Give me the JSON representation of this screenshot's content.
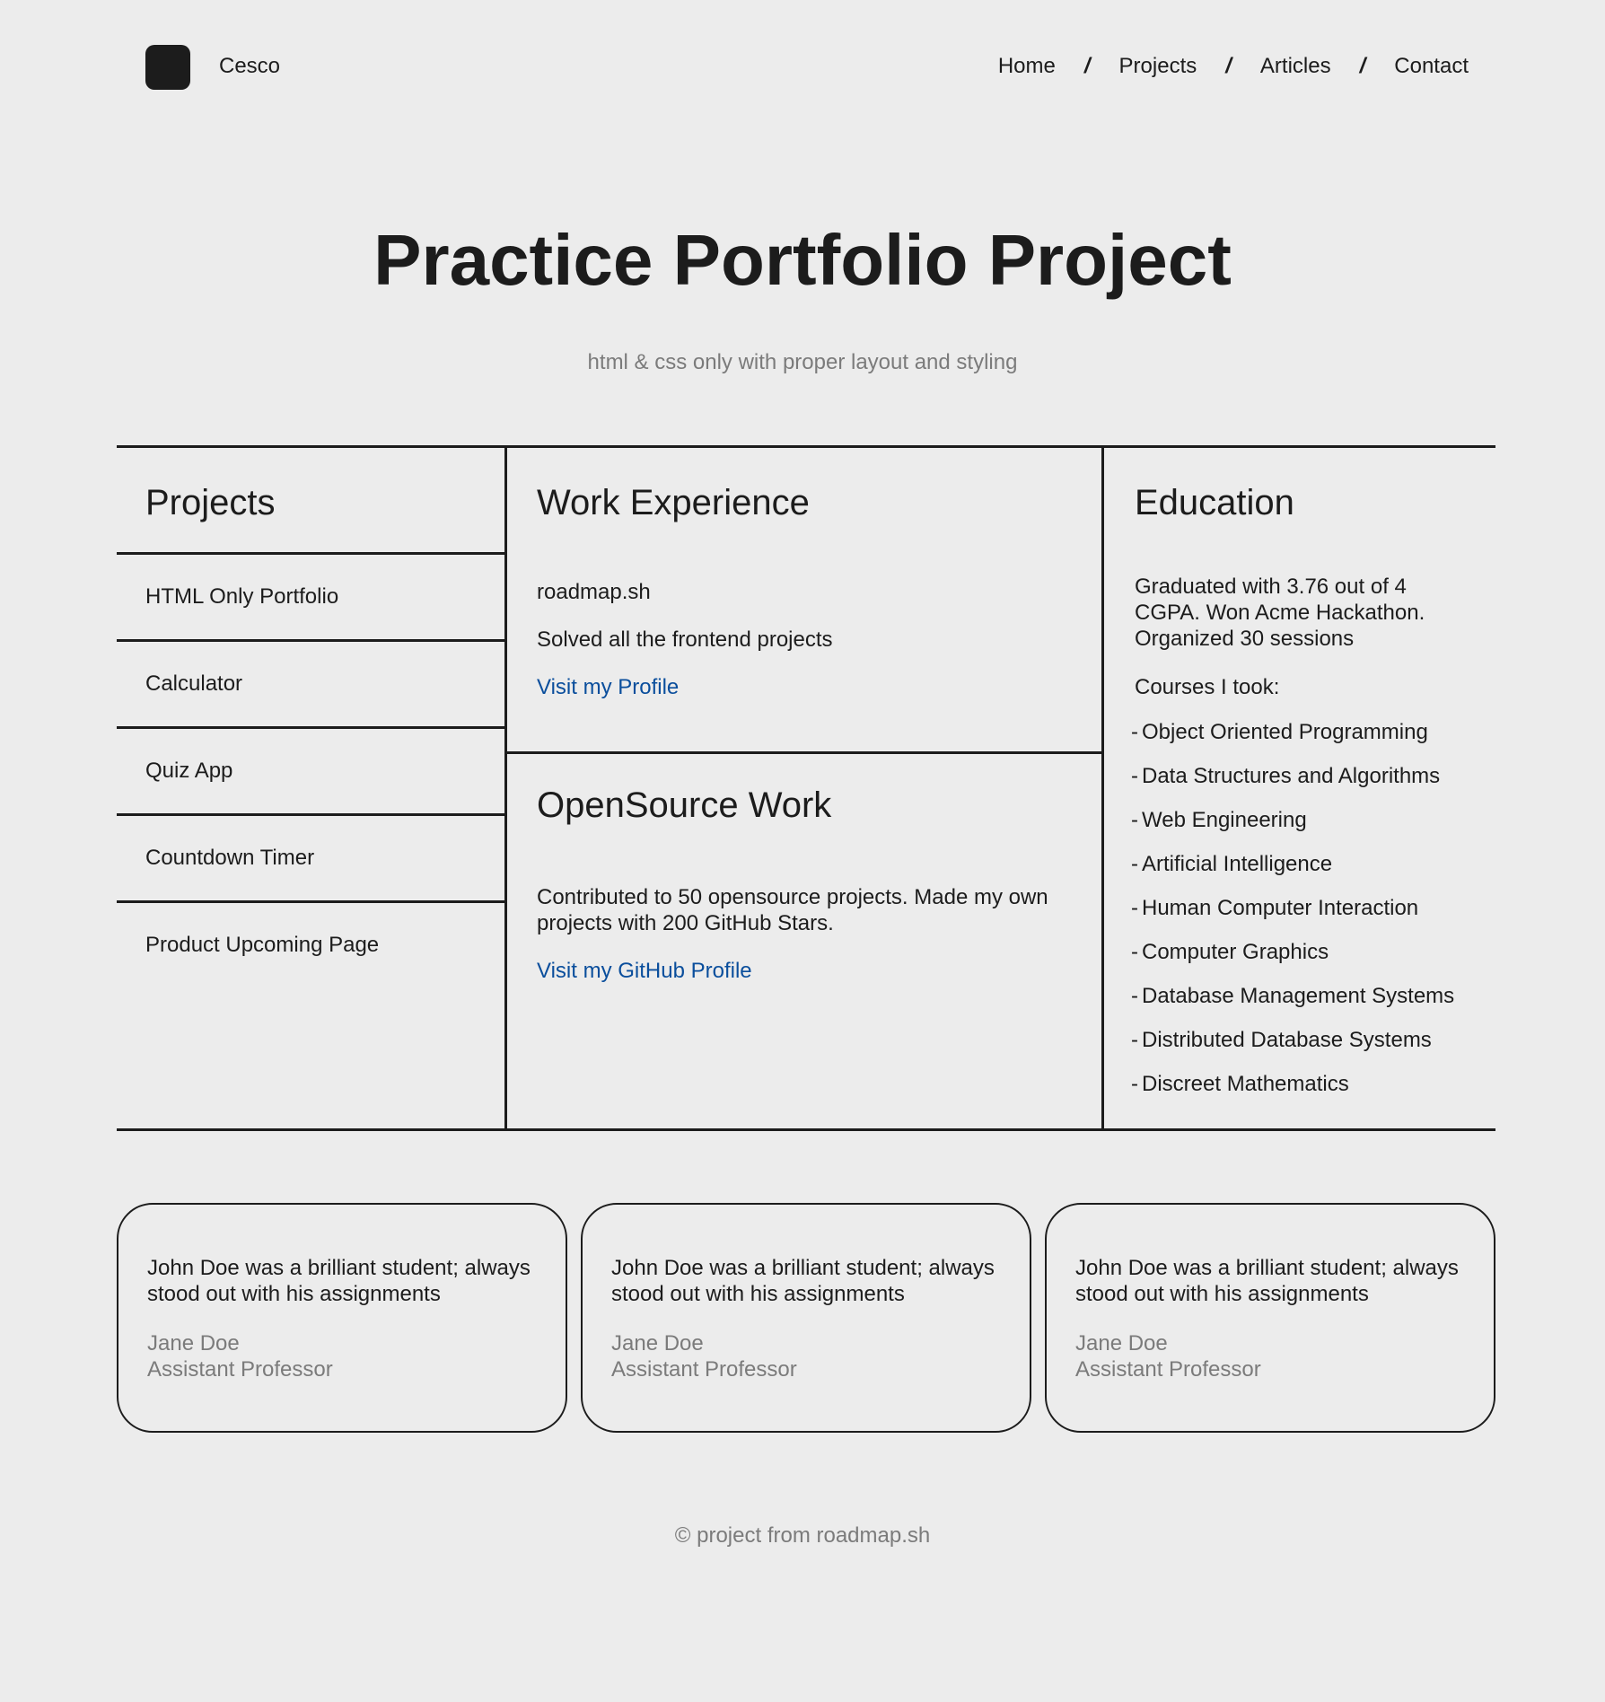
{
  "header": {
    "brand": "Cesco",
    "nav": [
      {
        "label": "Home"
      },
      {
        "label": "Projects"
      },
      {
        "label": "Articles"
      },
      {
        "label": "Contact"
      }
    ],
    "separator": "/"
  },
  "hero": {
    "title": "Practice Portfolio Project",
    "subtitle": "html & css only with proper layout and styling"
  },
  "projects": {
    "title": "Projects",
    "items": [
      "HTML Only Portfolio",
      "Calculator",
      "Quiz App",
      "Countdown Timer",
      "Product Upcoming Page"
    ]
  },
  "work": {
    "title": "Work Experience",
    "company": "roadmap.sh",
    "description": "Solved all the frontend projects",
    "link": "Visit my Profile"
  },
  "opensource": {
    "title": "OpenSource Work",
    "description": "Contributed to 50 opensource projects. Made my own projects with 200 GitHub Stars.",
    "link": "Visit my GitHub Profile"
  },
  "education": {
    "title": "Education",
    "description": "Graduated with 3.76 out of 4 CGPA. Won Acme Hackathon. Organized 30 sessions",
    "courses_label": "Courses I took:",
    "bullet": "-",
    "courses": [
      "Object Oriented Programming",
      "Data Structures and Algorithms",
      "Web Engineering",
      "Artificial Intelligence",
      "Human Computer Interaction",
      "Computer Graphics",
      "Database Management Systems",
      "Distributed Database Systems",
      "Discreet Mathematics"
    ]
  },
  "testimonials": [
    {
      "quote": "John Doe was a brilliant student; always stood out with his assignments",
      "author": "Jane Doe",
      "role": "Assistant Professor"
    },
    {
      "quote": "John Doe was a brilliant student; always stood out with his assignments",
      "author": "Jane Doe",
      "role": "Assistant Professor"
    },
    {
      "quote": "John Doe was a brilliant student; always stood out with his assignments",
      "author": "Jane Doe",
      "role": "Assistant Professor"
    }
  ],
  "footer": {
    "text": "© project from roadmap.sh"
  },
  "colors": {
    "background": "#ececec",
    "text": "#1c1c1c",
    "muted": "#7b7b7b",
    "link": "#0a4e9c"
  }
}
